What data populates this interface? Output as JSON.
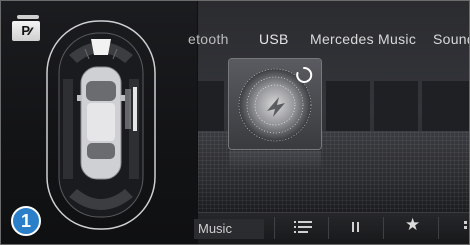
{
  "parking": {
    "p_button_label": "P",
    "p_button_icon": "park-assist-icon",
    "indicator_number": "1"
  },
  "media": {
    "tabs": [
      "etooth",
      "USB",
      "Mercedes Music",
      "Sound"
    ],
    "source_label": "Music",
    "colors": {
      "accent": "#2a7fc8",
      "text": "#d9d9d9"
    }
  },
  "controls": {
    "list_icon": "playlist-icon",
    "pause_icon": "pause-icon",
    "favorite_icon": "star-icon",
    "favorite_glyph": "★",
    "more_icon": "more-icon"
  }
}
